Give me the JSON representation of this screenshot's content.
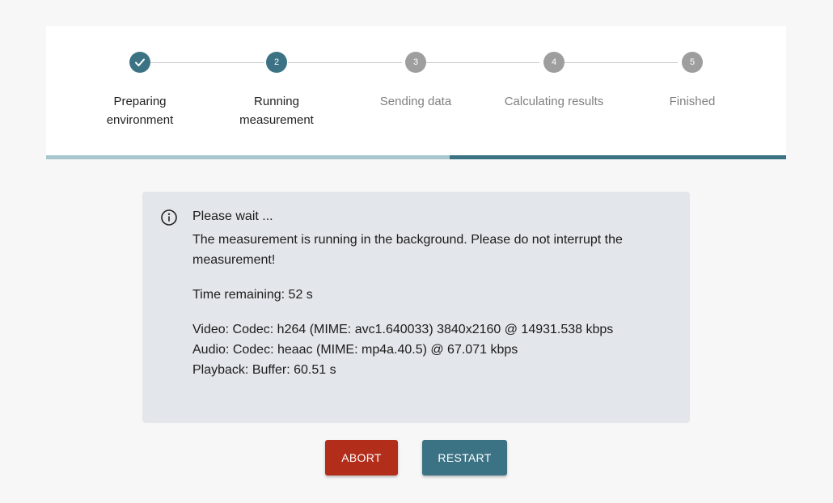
{
  "colors": {
    "accent": "#3b7385",
    "pending": "#9e9e9e",
    "abort": "#b32d1b",
    "progress_track": "#a8c7cd",
    "panel_bg": "#e3e6ea"
  },
  "steps": [
    {
      "label": "Preparing environment",
      "line1": "Preparing",
      "line2": "environment",
      "number": "1",
      "state": "done",
      "icon": "check-icon"
    },
    {
      "label": "Running measurement",
      "line1": "Running",
      "line2": "measurement",
      "number": "2",
      "state": "active"
    },
    {
      "label": "Sending data",
      "line1": "Sending data",
      "line2": "",
      "number": "3",
      "state": "pending"
    },
    {
      "label": "Calculating results",
      "line1": "Calculating results",
      "line2": "",
      "number": "4",
      "state": "pending"
    },
    {
      "label": "Finished",
      "line1": "Finished",
      "line2": "",
      "number": "5",
      "state": "pending"
    }
  ],
  "progress": {
    "fraction": 0.455
  },
  "info": {
    "icon": "info-icon",
    "title": "Please wait ...",
    "message": "The measurement is running in the background. Please do not interrupt the measurement!",
    "time_remaining": "Time remaining: 52 s",
    "video": "Video: Codec: h264 (MIME: avc1.640033) 3840x2160 @ 14931.538 kbps",
    "audio": "Audio: Codec: heaac (MIME: mp4a.40.5) @ 67.071 kbps",
    "playback": "Playback: Buffer: 60.51 s"
  },
  "buttons": {
    "abort_label": "ABORT",
    "restart_label": "RESTART"
  }
}
